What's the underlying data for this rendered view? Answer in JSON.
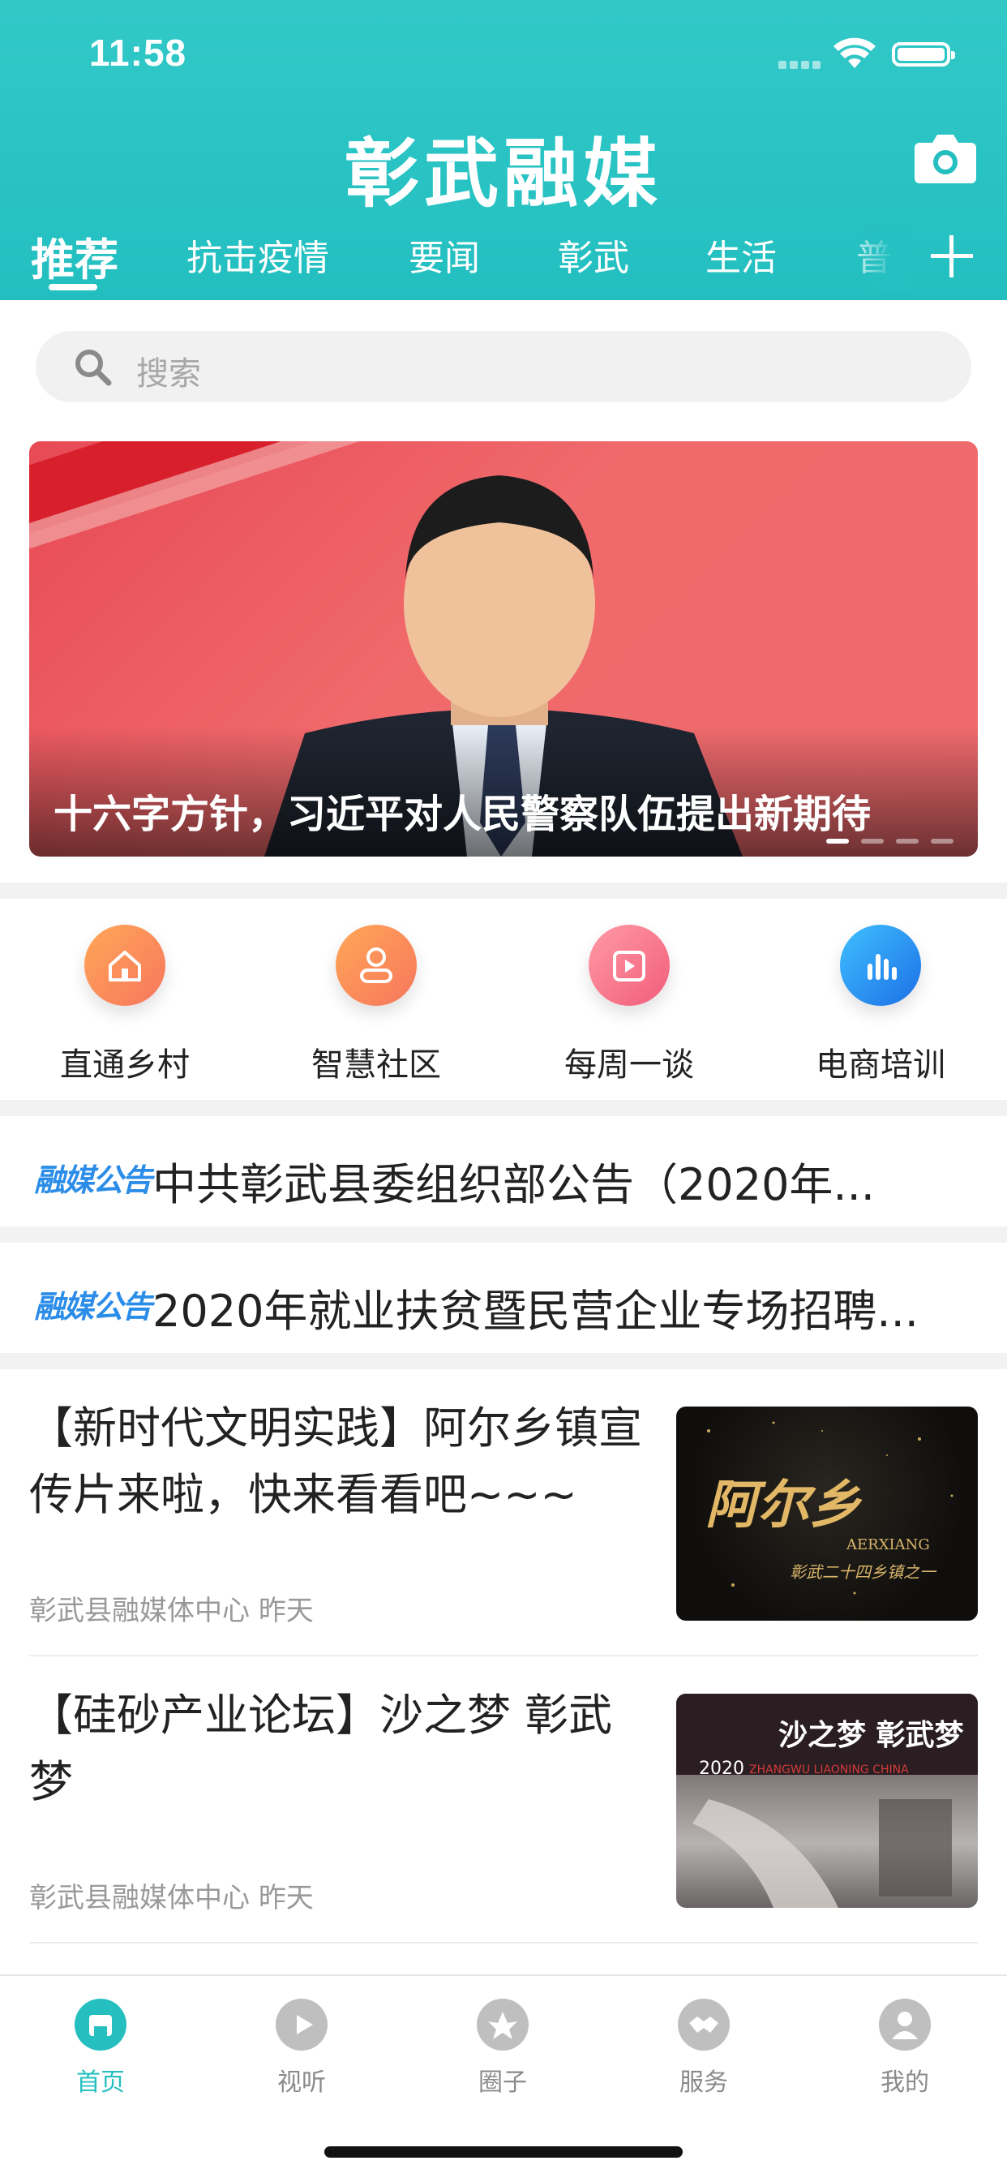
{
  "status_bar": {
    "time": "11:58"
  },
  "header": {
    "title": "彰武融媒"
  },
  "tabs": [
    {
      "label": "推荐"
    },
    {
      "label": "抗击疫情"
    },
    {
      "label": "要闻"
    },
    {
      "label": "彰武"
    },
    {
      "label": "生活"
    },
    {
      "label": "普"
    }
  ],
  "search": {
    "placeholder": "搜索"
  },
  "banner": {
    "title": "十六字方针，习近平对人民警察队伍提出新期待",
    "page_count": 4,
    "current_page": 1
  },
  "quick_entries": [
    {
      "label": "直通乡村",
      "icon": "home-icon"
    },
    {
      "label": "智慧社区",
      "icon": "person-icon"
    },
    {
      "label": "每周一谈",
      "icon": "play-icon"
    },
    {
      "label": "电商培训",
      "icon": "bar-chart-icon"
    }
  ],
  "notices": [
    {
      "tag": "融媒公告",
      "text": "中共彰武县委组织部公告（2020年..."
    },
    {
      "tag": "融媒公告",
      "text": "2020年就业扶贫暨民营企业专场招聘..."
    }
  ],
  "articles": [
    {
      "title": "【新时代文明实践】阿尔乡镇宣传片来啦，快来看看吧~~~",
      "source": "彰武县融媒体中心",
      "time": "昨天",
      "thumb_text": {
        "main": "阿尔乡",
        "sub": "AERXIANG",
        "caption": "彰武二十四乡镇之一"
      }
    },
    {
      "title": "【硅砂产业论坛】沙之梦 彰武梦",
      "source": "彰武县融媒体中心",
      "time": "昨天",
      "thumb_text": {
        "main": "沙之梦 彰武梦",
        "year": "2020",
        "sub": "ZHANGWU LIAONING CHINA"
      }
    }
  ],
  "tabbar": [
    {
      "label": "首页",
      "active": true,
      "icon": "home-tab-icon"
    },
    {
      "label": "视听",
      "active": false,
      "icon": "play-tab-icon"
    },
    {
      "label": "圈子",
      "active": false,
      "icon": "circle-tab-icon"
    },
    {
      "label": "服务",
      "active": false,
      "icon": "handshake-tab-icon"
    },
    {
      "label": "我的",
      "active": false,
      "icon": "profile-tab-icon"
    }
  ],
  "colors": {
    "accent": "#25bfc0",
    "notice_tag": "#2b8de8",
    "banner_bg": "#ee6a6d"
  }
}
